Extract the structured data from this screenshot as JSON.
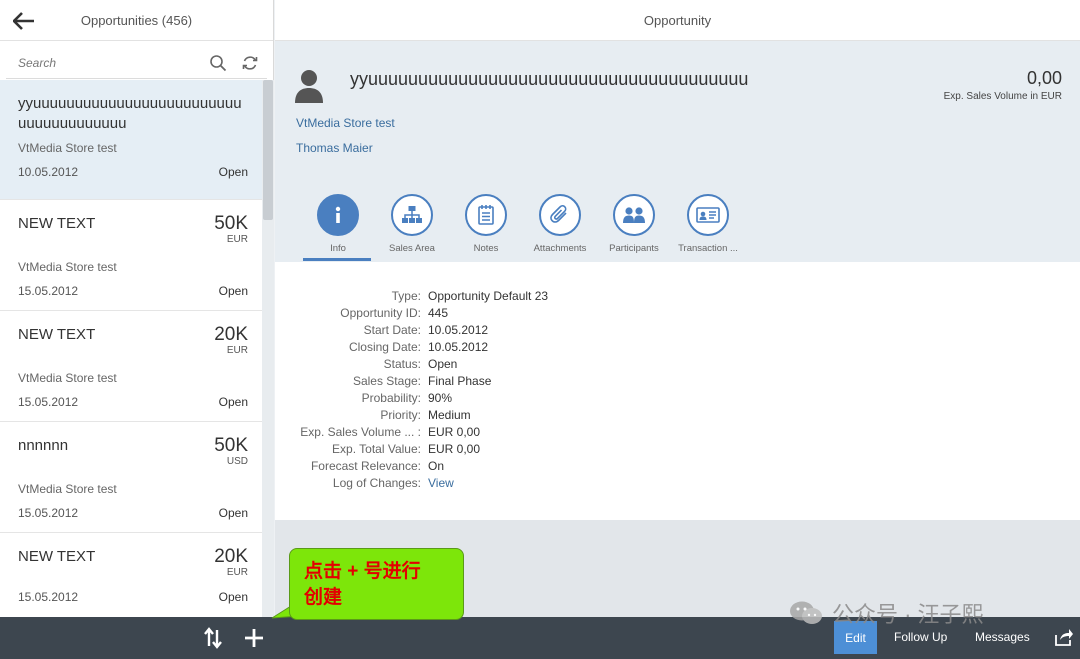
{
  "master": {
    "title": "Opportunities (456)",
    "search_placeholder": "Search",
    "items": [
      {
        "title": "yyuuuuuuuuuuuuuuuuuuuuuuuuuuuuuuuuuuuuuu",
        "account": "VtMedia Store test",
        "date": "10.05.2012",
        "status": "Open",
        "amount": "",
        "currency": ""
      },
      {
        "title": "NEW TEXT",
        "account": "VtMedia Store test",
        "date": "15.05.2012",
        "status": "Open",
        "amount": "50K",
        "currency": "EUR"
      },
      {
        "title": "NEW TEXT",
        "account": "VtMedia Store test",
        "date": "15.05.2012",
        "status": "Open",
        "amount": "20K",
        "currency": "EUR"
      },
      {
        "title": "nnnnnn",
        "account": "VtMedia Store test",
        "date": "15.05.2012",
        "status": "Open",
        "amount": "50K",
        "currency": "USD"
      },
      {
        "title": "NEW TEXT",
        "account": "",
        "date": "15.05.2012",
        "status": "Open",
        "amount": "20K",
        "currency": "EUR"
      }
    ]
  },
  "detail": {
    "title": "Opportunity",
    "object_title": "yyuuuuuuuuuuuuuuuuuuuuuuuuuuuuuuuuuuuuuu",
    "number": "0,00",
    "number_unit": "Exp. Sales Volume in EUR",
    "account": "VtMedia Store test",
    "contact": "Thomas Maier",
    "tabs": [
      {
        "label": "Info",
        "icon": "info-icon"
      },
      {
        "label": "Sales Area",
        "icon": "org-chart-icon"
      },
      {
        "label": "Notes",
        "icon": "notes-icon"
      },
      {
        "label": "Attachments",
        "icon": "paperclip-icon"
      },
      {
        "label": "Participants",
        "icon": "people-icon"
      },
      {
        "label": "Transaction ...",
        "icon": "id-card-icon"
      }
    ],
    "fields": [
      {
        "label": "Type:",
        "value": "Opportunity Default 23"
      },
      {
        "label": "Opportunity ID:",
        "value": "445"
      },
      {
        "label": "Start Date:",
        "value": "10.05.2012"
      },
      {
        "label": "Closing Date:",
        "value": "10.05.2012"
      },
      {
        "label": "Status:",
        "value": "Open"
      },
      {
        "label": "Sales Stage:",
        "value": "Final Phase"
      },
      {
        "label": "Probability:",
        "value": "90%"
      },
      {
        "label": "Priority:",
        "value": "Medium"
      },
      {
        "label": "Exp. Sales Volume ... :",
        "value": "EUR 0,00"
      },
      {
        "label": "Exp. Total Value:",
        "value": "EUR 0,00"
      },
      {
        "label": "Forecast Relevance:",
        "value": "On"
      },
      {
        "label": "Log of Changes:",
        "value": "View"
      }
    ]
  },
  "footer": {
    "edit": "Edit",
    "follow_up": "Follow Up",
    "messages": "Messages"
  },
  "callout": {
    "line1": "点击 + 号进行",
    "line2": "创建"
  },
  "watermark": {
    "text": "公众号 · 汪子熙"
  },
  "colors": {
    "accent": "#4a7fc0",
    "link": "#3a6d9e",
    "footer": "#3d464f",
    "callout_bg": "#7de60a",
    "callout_text": "#e30000"
  }
}
